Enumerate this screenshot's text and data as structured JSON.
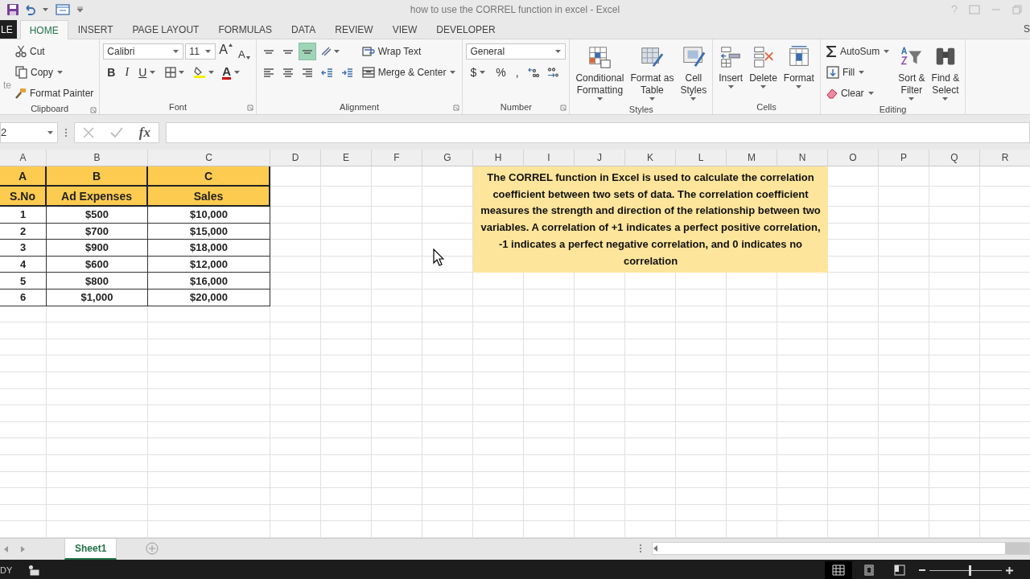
{
  "title_bar": {
    "title": "how to use the CORREL function in excel - Excel"
  },
  "ribbon_tabs": [
    {
      "label": "LE",
      "kind": "file",
      "selected": false
    },
    {
      "label": "HOME",
      "kind": "tab",
      "selected": true
    },
    {
      "label": "INSERT",
      "kind": "tab",
      "selected": false
    },
    {
      "label": "PAGE LAYOUT",
      "kind": "tab",
      "selected": false
    },
    {
      "label": "FORMULAS",
      "kind": "tab",
      "selected": false
    },
    {
      "label": "DATA",
      "kind": "tab",
      "selected": false
    },
    {
      "label": "REVIEW",
      "kind": "tab",
      "selected": false
    },
    {
      "label": "VIEW",
      "kind": "tab",
      "selected": false
    },
    {
      "label": "DEVELOPER",
      "kind": "tab",
      "selected": false
    }
  ],
  "account": {
    "label": "S"
  },
  "ribbon_groups": [
    {
      "label": "Clipboard",
      "sections": [
        {
          "kind": "paste",
          "label": "te"
        },
        {
          "kind": "stack",
          "lines": [
            {
              "items": [
                {
                  "kind": "cut",
                  "label": "Cut"
                }
              ]
            },
            {
              "items": [
                {
                  "kind": "copy",
                  "label": "Copy"
                }
              ]
            },
            {
              "items": [
                {
                  "kind": "painter",
                  "label": "Format Painter"
                }
              ]
            }
          ]
        }
      ]
    },
    {
      "label": "Font",
      "sections": [
        {
          "kind": "stack",
          "lines": [
            {
              "items": [
                {
                  "kind": "font-combo",
                  "value": "Calibri"
                },
                {
                  "kind": "size-combo",
                  "value": "11"
                },
                {
                  "kind": "grow",
                  "label": "A"
                },
                {
                  "kind": "shrink",
                  "label": "A"
                }
              ]
            },
            {
              "items": [
                {
                  "kind": "bold",
                  "label": "B"
                },
                {
                  "kind": "italic",
                  "label": "I"
                },
                {
                  "kind": "underline",
                  "label": "U"
                },
                {
                  "kind": "borders"
                },
                {
                  "kind": "fill-color"
                },
                {
                  "kind": "font-color",
                  "label": "A"
                }
              ]
            }
          ]
        }
      ]
    },
    {
      "label": "Alignment",
      "sections": [
        {
          "kind": "stack",
          "lines": [
            {
              "items": [
                {
                  "kind": "align-top",
                  "selected": false
                },
                {
                  "kind": "align-middle",
                  "selected": false
                },
                {
                  "kind": "align-bottom",
                  "selected": true
                },
                {
                  "kind": "orientation"
                }
              ]
            },
            {
              "items": [
                {
                  "kind": "align-left",
                  "selected": false
                },
                {
                  "kind": "align-center",
                  "selected": false
                },
                {
                  "kind": "align-right",
                  "selected": false
                },
                {
                  "kind": "indent-dec"
                },
                {
                  "kind": "indent-inc"
                }
              ]
            }
          ]
        },
        {
          "kind": "stack",
          "lines": [
            {
              "items": [
                {
                  "kind": "wrap",
                  "label": "Wrap Text"
                }
              ]
            },
            {
              "items": [
                {
                  "kind": "merge",
                  "label": "Merge & Center"
                }
              ]
            }
          ]
        }
      ]
    },
    {
      "label": "Number",
      "sections": [
        {
          "kind": "stack",
          "lines": [
            {
              "items": [
                {
                  "kind": "number-combo",
                  "value": "General"
                }
              ]
            },
            {
              "items": [
                {
                  "kind": "currency",
                  "label": "$"
                },
                {
                  "kind": "percent",
                  "label": "%"
                },
                {
                  "kind": "comma",
                  "label": ","
                },
                {
                  "kind": "decimal-inc"
                },
                {
                  "kind": "decimal-dec"
                }
              ]
            }
          ]
        }
      ]
    },
    {
      "label": "Styles",
      "sections": [
        {
          "kind": "large",
          "items": [
            {
              "kind": "cond-format",
              "label": "Conditional\nFormatting"
            },
            {
              "kind": "format-table",
              "label": "Format as\nTable"
            },
            {
              "kind": "cell-styles",
              "label": "Cell\nStyles"
            }
          ]
        }
      ]
    },
    {
      "label": "Cells",
      "sections": [
        {
          "kind": "large",
          "items": [
            {
              "kind": "insert-cells",
              "label": "Insert"
            },
            {
              "kind": "delete-cells",
              "label": "Delete"
            },
            {
              "kind": "format-cells",
              "label": "Format"
            }
          ]
        }
      ]
    },
    {
      "label": "Editing",
      "sections": [
        {
          "kind": "stack",
          "lines": [
            {
              "items": [
                {
                  "kind": "autosum",
                  "label": "AutoSum"
                }
              ]
            },
            {
              "items": [
                {
                  "kind": "fill",
                  "label": "Fill"
                }
              ]
            },
            {
              "items": [
                {
                  "kind": "clear",
                  "label": "Clear"
                }
              ]
            }
          ]
        },
        {
          "kind": "large",
          "items": [
            {
              "kind": "sort",
              "label": "Sort &\nFilter"
            },
            {
              "kind": "find",
              "label": "Find &\nSelect"
            }
          ]
        }
      ]
    }
  ],
  "formula_bar": {
    "name_box": "2",
    "fx": "fx"
  },
  "sheet": {
    "columns": [
      "A",
      "B",
      "C",
      "D",
      "E",
      "F",
      "G",
      "H",
      "I",
      "J",
      "K",
      "L",
      "M",
      "N",
      "O",
      "P",
      "Q",
      "R"
    ],
    "rows": [
      [
        {
          "text": "A",
          "kind": "header"
        },
        {
          "text": "B",
          "kind": "header"
        },
        {
          "text": "C",
          "kind": "header"
        }
      ],
      [
        {
          "text": "S.No",
          "kind": "header"
        },
        {
          "text": "Ad Expenses",
          "kind": "header"
        },
        {
          "text": "Sales",
          "kind": "header"
        }
      ],
      [
        {
          "text": "1",
          "kind": "data"
        },
        {
          "text": "$500",
          "kind": "data"
        },
        {
          "text": "$10,000",
          "kind": "data"
        }
      ],
      [
        {
          "text": "2",
          "kind": "data"
        },
        {
          "text": "$700",
          "kind": "data"
        },
        {
          "text": "$15,000",
          "kind": "data"
        }
      ],
      [
        {
          "text": "3",
          "kind": "data"
        },
        {
          "text": "$900",
          "kind": "data"
        },
        {
          "text": "$18,000",
          "kind": "data"
        }
      ],
      [
        {
          "text": "4",
          "kind": "data"
        },
        {
          "text": "$600",
          "kind": "data"
        },
        {
          "text": "$12,000",
          "kind": "data"
        }
      ],
      [
        {
          "text": "5",
          "kind": "data"
        },
        {
          "text": "$800",
          "kind": "data"
        },
        {
          "text": "$16,000",
          "kind": "data"
        }
      ],
      [
        {
          "text": "6",
          "kind": "data"
        },
        {
          "text": "$1,000",
          "kind": "data"
        },
        {
          "text": "$20,000",
          "kind": "data"
        }
      ]
    ],
    "note": {
      "text": "The CORREL function in Excel is used to calculate the correlation coefficient between two sets of data. The correlation coefficient measures the strength and direction of the relationship between two variables. A correlation of +1 indicates a perfect positive correlation, -1 indicates a perfect negative correlation, and 0 indicates no correlation"
    }
  },
  "sheet_tabs": [
    {
      "label": "Sheet1",
      "selected": true
    }
  ],
  "status_bar": {
    "mode": "DY",
    "views": [
      {
        "selected": true
      },
      {
        "selected": false
      },
      {
        "selected": false
      }
    ],
    "zoom": {
      "level": 0.56
    }
  }
}
